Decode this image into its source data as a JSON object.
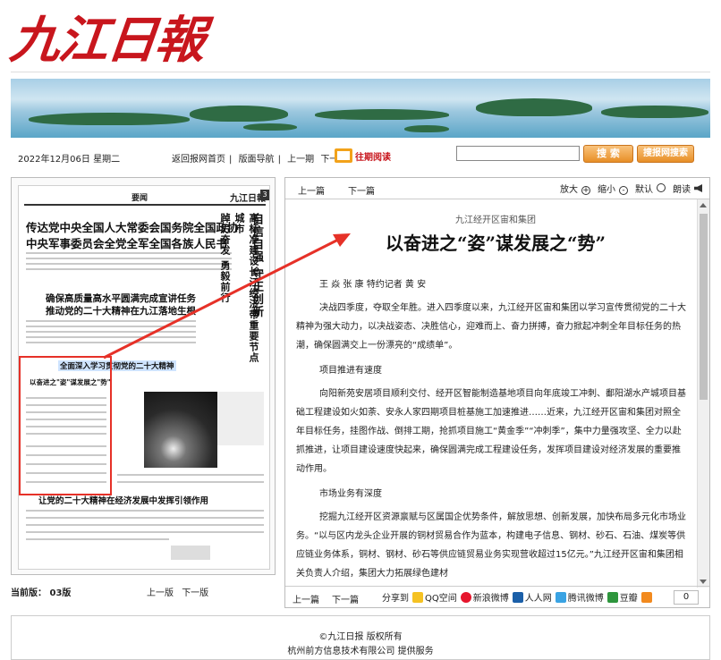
{
  "masthead": {
    "logo": "九江日報"
  },
  "toolbar": {
    "date": "2022年12月06日 星期二",
    "links": [
      "返回报网首页",
      "版面导航",
      "上一期",
      "下一期"
    ],
    "archive": "往期阅读",
    "search_placeholder": "",
    "search_button": "搜 索",
    "advanced_search_button": "搜报网搜索"
  },
  "thumbnail": {
    "section_header": "要闻",
    "brand": "九江日報",
    "page_badge": "3",
    "titles": [
      "传达党中央全国人大常委会国务院全国政协",
      "中央军事委员会全党全军全国各族人民书",
      "确保高质量高水平圆满完成宣讲任务",
      "推动党的二十大精神在九江落地生根",
      "全面深入学习贯彻党的二十大精神",
      "以奋进之\"姿\"谋发展之\"势\"",
      "让党的二十大精神在经济发展中发挥引领作用"
    ],
    "vert_titles": [
      "自信自强 守正创新",
      "高标准建设长江经济带重要节点城市",
      "踔厉奋发 勇毅前行"
    ]
  },
  "left_nav": {
    "current_page_label": "当前版：",
    "current_page": "03版",
    "prev_page": "上一版",
    "next_page": "下一版"
  },
  "article": {
    "top": {
      "prev": "上一篇",
      "next": "下一篇",
      "zoom_in": "放大",
      "zoom_out": "缩小",
      "reset": "默认",
      "read_aloud": "朗读"
    },
    "kicker": "九江经开区宙和集团",
    "headline": "以奋进之“姿”谋发展之“势”",
    "byline": "王 焱 张 康 特约记者 黄 安",
    "paragraphs": [
      "决战四季度，夺取全年胜。进入四季度以来，九江经开区宙和集团以学习宣传贯彻党的二十大精神为强大动力，以决战姿态、决胜信心，迎难而上、奋力拼搏，奋力掀起冲刺全年目标任务的热潮，确保圆满交上一份漂亮的“成绩单”。"
    ],
    "subhead1": "项目推进有速度",
    "paragraphs2": [
      "向阳新苑安居项目顺利交付、经开区智能制造基地项目向年底竣工冲刺、鄱阳湖水产城项目基础工程建设如火如荼、安永人家四期项目桩基施工加速推进……近来，九江经开区宙和集团对照全年目标任务，挂图作战、倒排工期，抢抓项目施工“黄金季”“冲刺季”，集中力量强攻坚、全力以赴抓推进，让项目建设速度快起来，确保圆满完成工程建设任务，发挥项目建设对经济发展的重要推动作用。"
    ],
    "subhead2": "市场业务有深度",
    "paragraphs3": [
      "挖掘九江经开区资源禀赋与区属国企优势条件，解放思想、创新发展，加快布局多元化市场业务。“以与区内龙头企业开展的铜材贸易合作为蓝本，构建电子信息、钢材、砂石、石油、煤炭等供应链业务体系，铜材、钢材、砂石等供应链贸易业务实现营收超过15亿元。”九江经开区宙和集团相关负责人介绍，集团大力拓展绿色建材"
    ],
    "bottom": {
      "prev": "上一篇",
      "next": "下一篇",
      "share_label": "分享到",
      "share_targets": [
        "QQ空间",
        "新浪微博",
        "人人网",
        "腾讯微博",
        "豆瓣"
      ],
      "share_count": "0"
    }
  },
  "footer": {
    "copyright": "©九江日报 版权所有",
    "provider": "杭州前方信息技术有限公司  提供服务"
  },
  "colors": {
    "accent_red": "#c8161d",
    "button_orange": "#e88f27",
    "highlight_red": "#e63128"
  }
}
